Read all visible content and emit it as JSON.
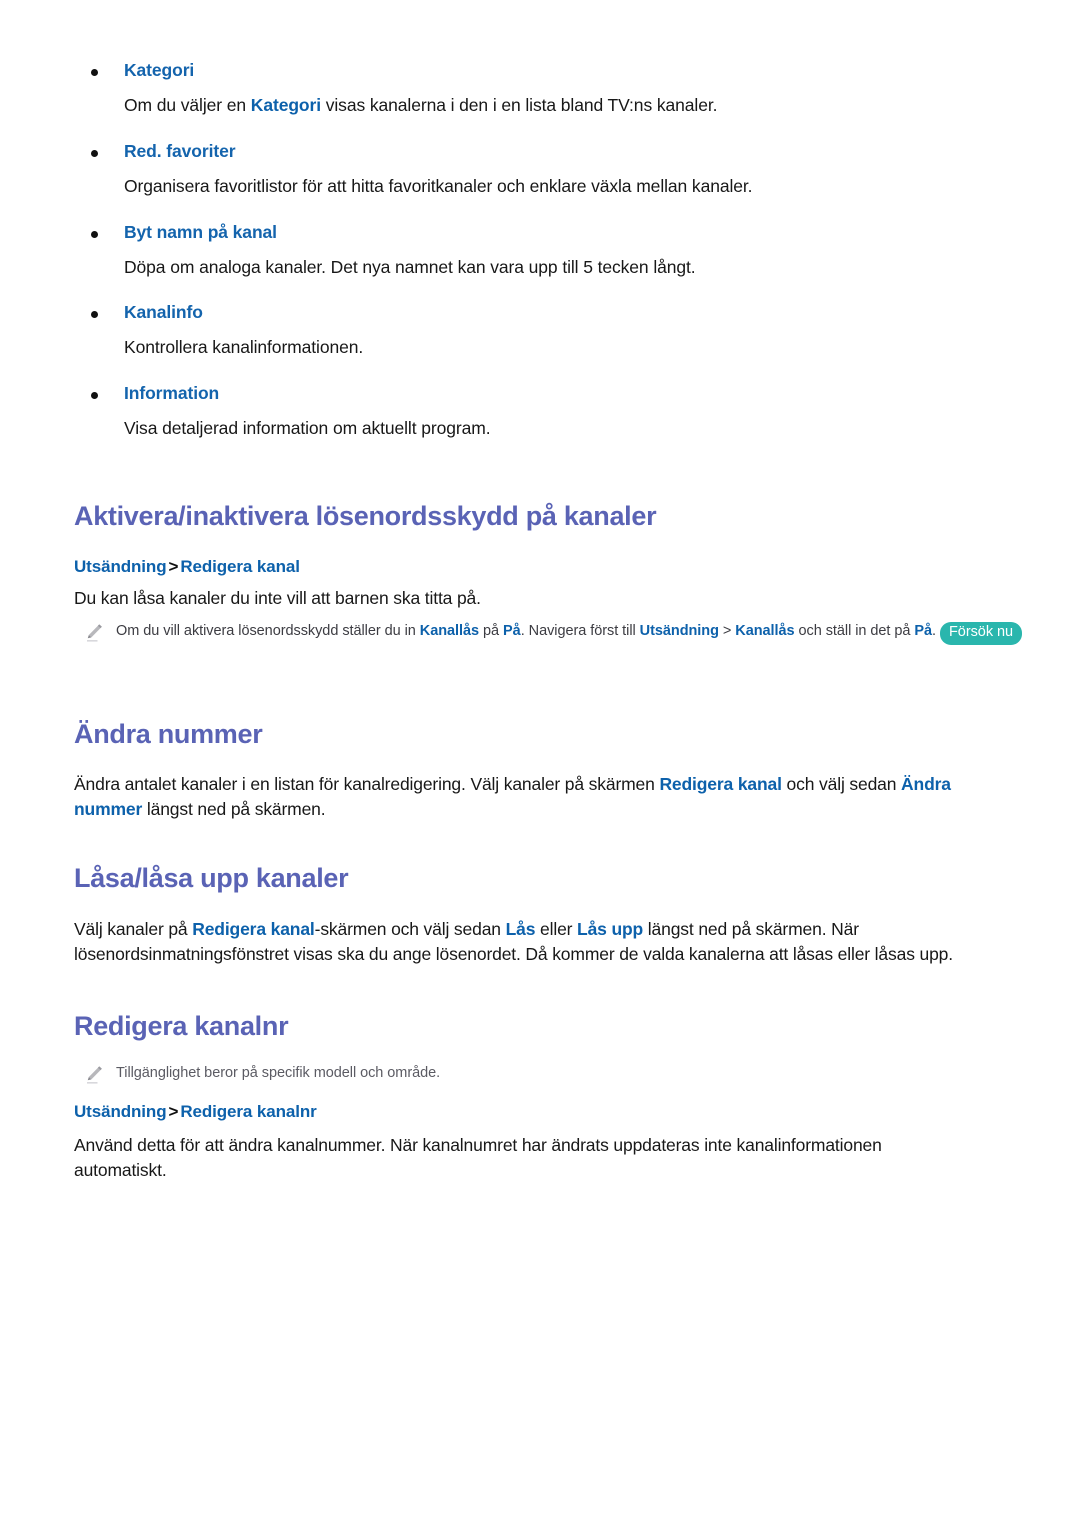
{
  "bullets": [
    {
      "label": "Kategori",
      "desc_pre": "Om du väljer en ",
      "desc_term": "Kategori",
      "desc_post": " visas kanalerna i den i en lista bland TV:ns kanaler."
    },
    {
      "label": "Red. favoriter",
      "desc_pre": "Organisera favoritlistor för att hitta favoritkanaler och enklare växla mellan kanaler.",
      "desc_term": "",
      "desc_post": ""
    },
    {
      "label": "Byt namn på kanal",
      "desc_pre": "Döpa om analoga kanaler. Det nya namnet kan vara upp till 5 tecken långt.",
      "desc_term": "",
      "desc_post": ""
    },
    {
      "label": "Kanalinfo",
      "desc_pre": "Kontrollera kanalinformationen.",
      "desc_term": "",
      "desc_post": ""
    },
    {
      "label": "Information",
      "desc_pre": "Visa detaljerad information om aktuellt program.",
      "desc_term": "",
      "desc_post": ""
    }
  ],
  "sections": {
    "password": {
      "title": "Aktivera/inaktivera lösenordsskydd på kanaler",
      "path_1": "Utsändning",
      "path_sep": ">",
      "path_2": "Redigera kanal",
      "body": "Du kan låsa kanaler du inte vill att barnen ska titta på.",
      "note": {
        "icon": "pencil-icon",
        "t1": "Om du vill aktivera lösenordsskydd ställer du in ",
        "b1": "Kanallås",
        "t2": " på ",
        "b2": "På",
        "t3": ". Navigera först till ",
        "b3": "Utsändning",
        "t4": " > ",
        "b4": "Kanallås",
        "t5": " och ställ in det på ",
        "b5": "På",
        "t6": ". ",
        "badge": "Försök nu"
      }
    },
    "change_number": {
      "title": "Ändra nummer",
      "t1": "Ändra antalet kanaler i en listan för kanalredigering. Välj kanaler på skärmen ",
      "b1": "Redigera kanal",
      "t2": " och välj sedan ",
      "b2": "Ändra nummer",
      "t3": " längst ned på skärmen."
    },
    "lock_unlock": {
      "title": "Låsa/låsa upp kanaler",
      "t1": "Välj kanaler på ",
      "b1": "Redigera kanal",
      "t2": "-skärmen och välj sedan ",
      "b2": "Lås",
      "t3": " eller ",
      "b3": "Lås upp",
      "t4": " längst ned på skärmen. När lösenordsinmatningsfönstret visas ska du ange lösenordet. Då kommer de valda kanalerna att låsas eller låsas upp."
    },
    "edit_channel_nr": {
      "title": "Redigera kanalnr",
      "note": {
        "icon": "pencil-icon",
        "text": "Tillgänglighet beror på specifik modell och område."
      },
      "path_1": "Utsändning",
      "path_sep": ">",
      "path_2": "Redigera kanalnr",
      "body": "Använd detta för att ändra kanalnummer. När kanalnumret har ändrats uppdateras inte kanalinformationen automatiskt."
    }
  },
  "colors": {
    "heading": "#5a63b5",
    "link": "#0d61ab",
    "badge_bg": "#2ab6ad",
    "body_text": "#181818",
    "note_text": "#5b5b63"
  }
}
